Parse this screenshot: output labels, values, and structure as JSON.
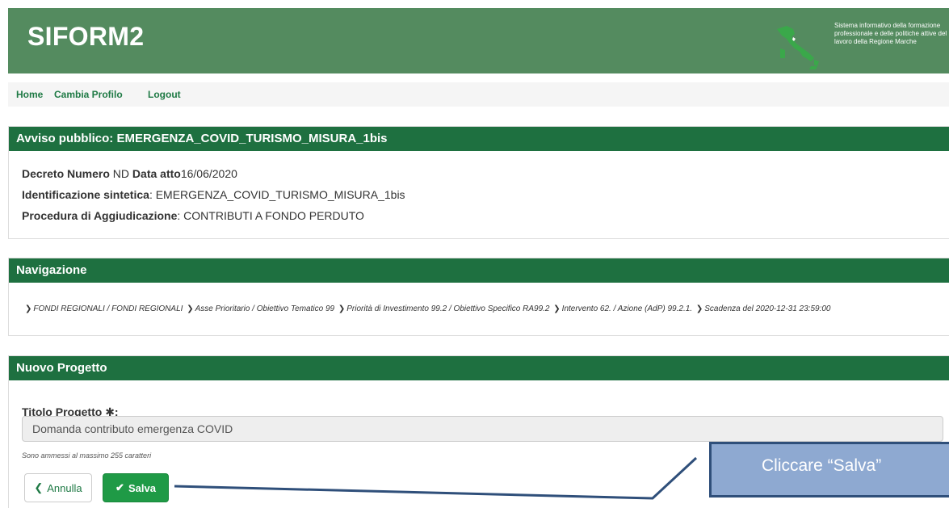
{
  "header": {
    "brand": "SIFORM2",
    "tagline": "Sistema informativo della formazione professionale e delle politiche attive del lavoro della Regione Marche",
    "map_icon": "italy-map-icon"
  },
  "nav": {
    "home": "Home",
    "cambia_profilo": "Cambia Profilo",
    "logout": "Logout"
  },
  "avviso": {
    "title": "Avviso pubblico: EMERGENZA_COVID_TURISMO_MISURA_1bis",
    "decreto_label": "Decreto Numero",
    "decreto_value": " ND ",
    "data_label": "Data atto",
    "data_value": "16/06/2020",
    "id_label": "Identificazione sintetica",
    "id_value": ": EMERGENZA_COVID_TURISMO_MISURA_1bis",
    "proc_label": "Procedura di Aggiudicazione",
    "proc_value": ": CONTRIBUTI A FONDO PERDUTO"
  },
  "navigazione": {
    "title": "Navigazione",
    "crumbs": [
      "FONDI REGIONALI / FONDI REGIONALI",
      "Asse Prioritario / Obiettivo Tematico 99",
      "Priorità di Investimento 99.2 / Obiettivo Specifico RA99.2",
      "Intervento 62. / Azione (AdP) 99.2.1.",
      "Scadenza del 2020-12-31 23:59:00"
    ],
    "separator": "❯"
  },
  "progetto": {
    "title": "Nuovo Progetto",
    "field_label": "Titolo Progetto",
    "required_mark": "✱",
    "label_colon": ":",
    "field_value": "Domanda contributo emergenza COVID",
    "hint": "Sono ammessi al massimo 255 caratteri",
    "cancel_icon": "❮",
    "cancel_label": "Annulla",
    "save_icon": "✔",
    "save_label": "Salva"
  },
  "callout": {
    "text": "Cliccare “Salva”",
    "fill": "#8ea9d1",
    "border": "#2f4f7a"
  },
  "colors": {
    "header_bg": "#548b5f",
    "panel_head_bg": "#1e7040",
    "save_btn": "#1f9a46",
    "link": "#1f7a45"
  }
}
